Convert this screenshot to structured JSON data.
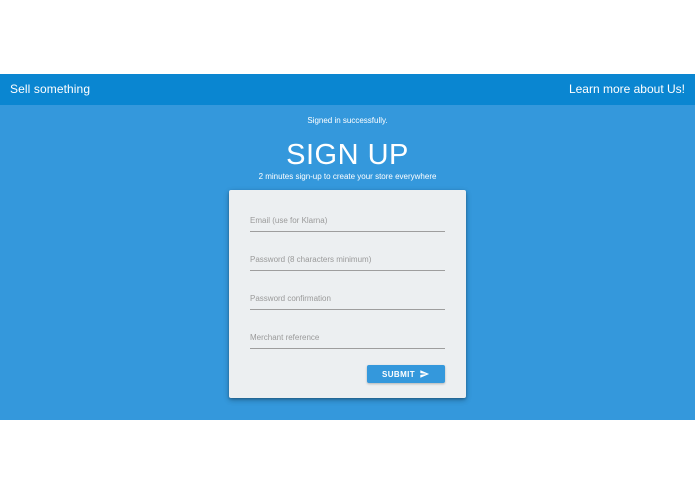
{
  "navbar": {
    "brand": "Sell something",
    "link": "Learn more about Us!"
  },
  "flash": {
    "message": "Signed in successfully."
  },
  "signup": {
    "title": "SIGN UP",
    "subtitle": "2 minutes sign-up to create your store everywhere",
    "fields": [
      {
        "placeholder": "Email (use for Klarna)",
        "value": ""
      },
      {
        "placeholder": "Password (8 characters minimum)",
        "value": ""
      },
      {
        "placeholder": "Password confirmation",
        "value": ""
      },
      {
        "placeholder": "Merchant reference",
        "value": ""
      }
    ],
    "submit_label": "SUBMIT",
    "submit_icon": "send-icon"
  },
  "colors": {
    "navbar": "#0a86d1",
    "hero": "#3498dc",
    "card": "#eceff1",
    "button": "#3498dc"
  }
}
